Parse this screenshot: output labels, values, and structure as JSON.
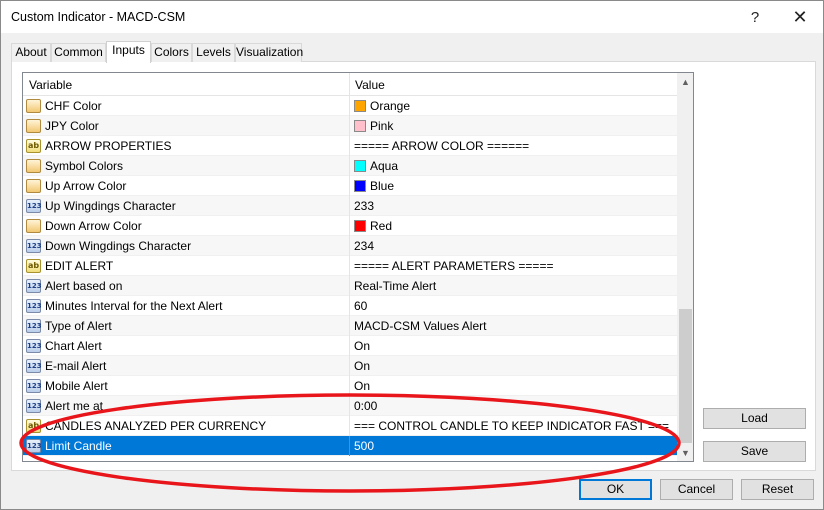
{
  "window": {
    "title": "Custom Indicator - MACD-CSM",
    "help_label": "?",
    "close_label": "✕"
  },
  "tabs": [
    {
      "label": "About"
    },
    {
      "label": "Common"
    },
    {
      "label": "Inputs",
      "active": true
    },
    {
      "label": "Colors"
    },
    {
      "label": "Levels"
    },
    {
      "label": "Visualization"
    }
  ],
  "grid": {
    "col_variable": "Variable",
    "col_value": "Value",
    "rows": [
      {
        "icon": "color",
        "icon_text": "",
        "name": "CHF Color",
        "value": "Orange",
        "swatch": "#ffa500"
      },
      {
        "icon": "color",
        "icon_text": "",
        "name": "JPY Color",
        "value": "Pink",
        "swatch": "#ffc0cb"
      },
      {
        "icon": "str",
        "icon_text": "ab",
        "name": "ARROW PROPERTIES",
        "value": "===== ARROW COLOR ======"
      },
      {
        "icon": "color",
        "icon_text": "",
        "name": "Symbol Colors",
        "value": "Aqua",
        "swatch": "#00ffff"
      },
      {
        "icon": "color",
        "icon_text": "",
        "name": "Up Arrow Color",
        "value": "Blue",
        "swatch": "#0000ff"
      },
      {
        "icon": "num",
        "icon_text": "123",
        "name": "Up Wingdings Character",
        "value": "233"
      },
      {
        "icon": "color",
        "icon_text": "",
        "name": "Down Arrow Color",
        "value": "Red",
        "swatch": "#ff0000"
      },
      {
        "icon": "num",
        "icon_text": "123",
        "name": "Down Wingdings Character",
        "value": "234"
      },
      {
        "icon": "str",
        "icon_text": "ab",
        "name": "EDIT ALERT",
        "value": "===== ALERT PARAMETERS ====="
      },
      {
        "icon": "num",
        "icon_text": "123",
        "name": "Alert based on",
        "value": "Real-Time Alert"
      },
      {
        "icon": "num",
        "icon_text": "123",
        "name": "Minutes Interval for the Next Alert",
        "value": "60"
      },
      {
        "icon": "num",
        "icon_text": "123",
        "name": "Type of Alert",
        "value": "MACD-CSM Values Alert"
      },
      {
        "icon": "num",
        "icon_text": "123",
        "name": "Chart Alert",
        "value": "On"
      },
      {
        "icon": "num",
        "icon_text": "123",
        "name": "E-mail Alert",
        "value": "On"
      },
      {
        "icon": "num",
        "icon_text": "123",
        "name": "Mobile Alert",
        "value": "On"
      },
      {
        "icon": "num",
        "icon_text": "123",
        "name": "Alert me at",
        "value": "0:00"
      },
      {
        "icon": "str",
        "icon_text": "ab",
        "name": "CANDLES ANALYZED PER CURRENCY",
        "value": "=== CONTROL CANDLE TO KEEP INDICATOR FAST ==="
      },
      {
        "icon": "num",
        "icon_text": "123",
        "name": "Limit Candle",
        "value": "500",
        "selected": true
      }
    ]
  },
  "buttons": {
    "load": "Load",
    "save": "Save",
    "ok": "OK",
    "cancel": "Cancel",
    "reset": "Reset"
  },
  "scroll_arrows": {
    "up": "▲",
    "down": "▼"
  },
  "colors": {
    "selection": "#0078d7",
    "annotation": "#e8151b"
  }
}
